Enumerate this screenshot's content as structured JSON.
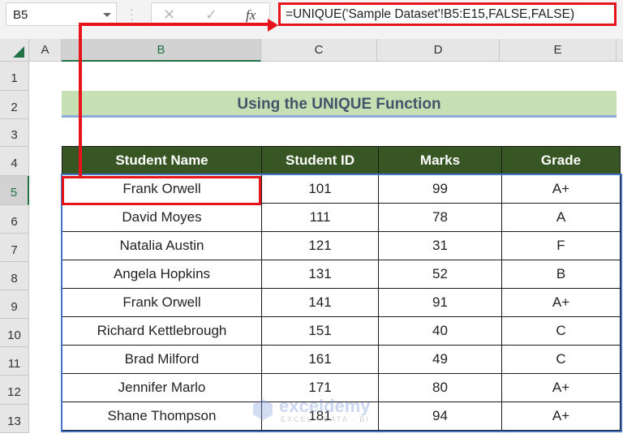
{
  "formula_bar": {
    "name_box": "B5",
    "cancel_icon": "✕",
    "enter_icon": "✓",
    "fx_label": "fx",
    "formula": "=UNIQUE('Sample Dataset'!B5:E15,FALSE,FALSE)"
  },
  "columns": [
    "A",
    "B",
    "C",
    "D",
    "E"
  ],
  "rows": [
    "1",
    "2",
    "3",
    "4",
    "5",
    "6",
    "7",
    "8",
    "9",
    "10",
    "11",
    "12",
    "13"
  ],
  "sheet": {
    "title": "Using the UNIQUE Function",
    "headers": [
      "Student Name",
      "Student ID",
      "Marks",
      "Grade"
    ],
    "records": [
      [
        "Frank Orwell",
        "101",
        "99",
        "A+"
      ],
      [
        "David Moyes",
        "111",
        "78",
        "A"
      ],
      [
        "Natalia Austin",
        "121",
        "31",
        "F"
      ],
      [
        "Angela Hopkins",
        "131",
        "52",
        "B"
      ],
      [
        "Frank Orwell",
        "141",
        "91",
        "A+"
      ],
      [
        "Richard Kettlebrough",
        "151",
        "40",
        "C"
      ],
      [
        "Brad Milford",
        "161",
        "49",
        "C"
      ],
      [
        "Jennifer Marlo",
        "171",
        "80",
        "A+"
      ],
      [
        "Shane Thompson",
        "181",
        "94",
        "A+"
      ]
    ]
  },
  "watermark": {
    "name": "exceldemy",
    "tagline": "EXCEL · DATA · BI"
  },
  "colors": {
    "header_bg": "#375623",
    "title_bg": "#c6e0b4",
    "highlight": "#e8141c",
    "excel_green": "#217346"
  }
}
